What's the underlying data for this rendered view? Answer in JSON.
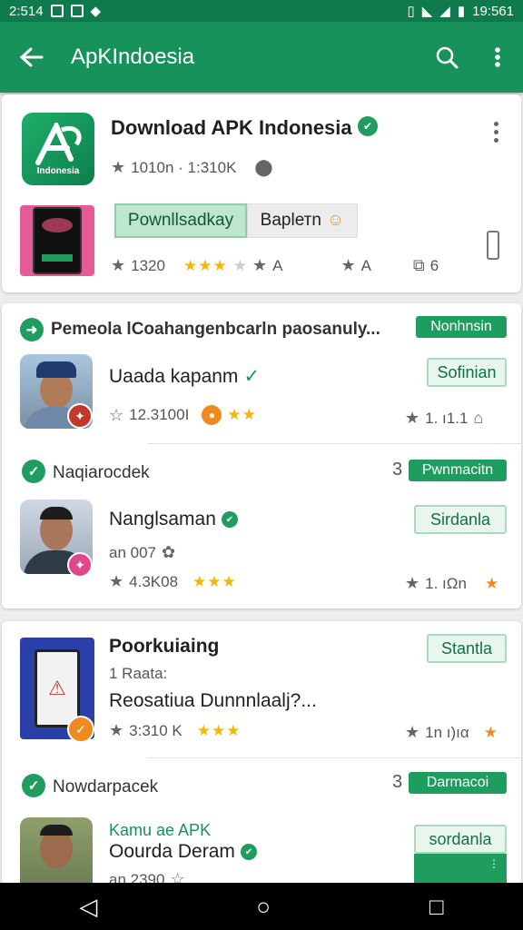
{
  "status": {
    "time_left": "2:514",
    "time_right": "19:561"
  },
  "appbar": {
    "title": "ApKIndoesia"
  },
  "header_card": {
    "app_name": "Download APK Indonesia",
    "logo_text": "Indonesia",
    "stats": "1010n · 1:310K",
    "primary_button": "Pownllsadkay",
    "secondary_button": "Baplетn",
    "rating_count": "1320",
    "a_label": "A",
    "a_label2": "A",
    "count": "6"
  },
  "section1": {
    "title": "Pemeola lCoahangenbcarln paosanuly...",
    "badge": "Nonhnsin",
    "item": {
      "name": "Uaada kapanm",
      "button": "Sofinian",
      "meta": "12.3100I",
      "stats": "1.  ı1.1"
    }
  },
  "section2": {
    "title": "Naqiarocdek",
    "count": "3",
    "badge": "Pwnmacitn",
    "item": {
      "name": "Nanglsaman",
      "line2": "an 007",
      "meta": "4.3K08",
      "button": "Sirdanla",
      "stats": "1.  ıΩn"
    }
  },
  "section3": {
    "name": "Poorkuiaing",
    "line2": "1 Raata:",
    "line3": "Reosatiua Dunnnlaalj?...",
    "meta": "3:310 K",
    "button": "Stantla",
    "stats": "1n ı)ıα"
  },
  "section4": {
    "title": "Nowdarpacek",
    "count": "3",
    "badge": "Darmacoi",
    "item": {
      "name_green": "Kamu ae APK",
      "name": "Oourda Deram",
      "line3": "an 2390",
      "button": "sordanla"
    }
  },
  "colors": {
    "primary": "#17925b",
    "dark": "#0f7a4c",
    "star": "#f2b705",
    "orange": "#ef8a21"
  }
}
